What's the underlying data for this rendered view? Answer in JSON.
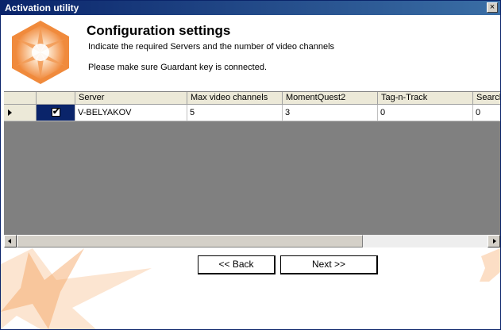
{
  "window": {
    "title": "Activation utility",
    "close_glyph": "×"
  },
  "header": {
    "title": "Configuration settings",
    "subtitle": "Indicate the required Servers and the number of video channels",
    "note": "Please make sure Guardant key is connected."
  },
  "grid": {
    "columns": [
      "",
      "Server",
      "Max video channels",
      "MomentQuest2",
      "Tag-n-Track",
      "Search"
    ],
    "rows": [
      {
        "checked": true,
        "check_glyph": "✔",
        "server": "V-BELYAKOV",
        "max_video_channels": "5",
        "momentquest2": "3",
        "tag_n_track": "0",
        "search": "0"
      }
    ]
  },
  "buttons": {
    "back": "<< Back",
    "next": "Next >>"
  },
  "colors": {
    "accent_orange": "#f5a05a",
    "title_bar": "#0a246a",
    "grid_empty": "#808080"
  }
}
